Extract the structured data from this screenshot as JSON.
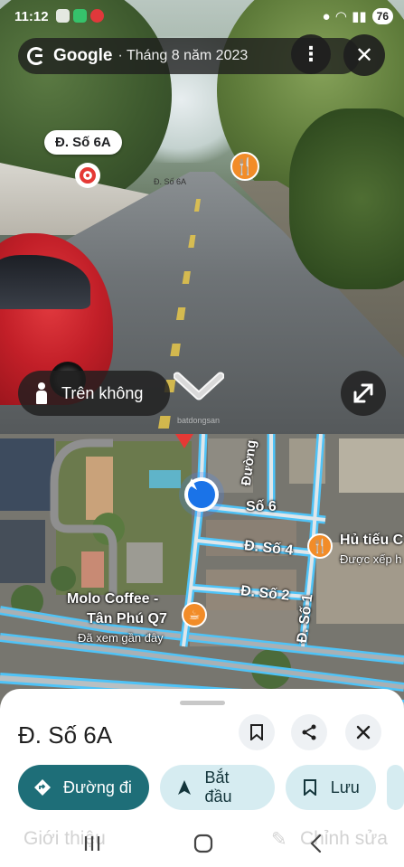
{
  "status_bar": {
    "time": "11:12",
    "battery": "76"
  },
  "street_view": {
    "provider": "Google",
    "capture_date": "· Tháng 8 năm 2023",
    "more_label": "⋮",
    "close_label": "✕",
    "place_label": "Đ. Số 6A",
    "aerial_button": "Trên không",
    "street_tag": "Đ. Số 6A",
    "watermark": "batdongsan"
  },
  "map": {
    "labels": {
      "duong": "Đường",
      "so6": "Số 6",
      "so4": "Đ. Số 4",
      "so2": "Đ. Số 2",
      "so1": "Đ. Số 1",
      "hu_tieu": "Hủ tiếu C",
      "hu_tieu_sub": "Được xếp h",
      "molo": "Molo Coffee -",
      "molo2": "Tân Phú Q7",
      "molo_sub": "Đã xem gần đây"
    }
  },
  "sheet": {
    "title": "Đ. Số 6A",
    "directions": "Đường đi",
    "start": "Bắt đầu",
    "save": "Lưu",
    "intro_tab": "Giới thiệu",
    "edit_tab": "Chỉnh sửa"
  },
  "colors": {
    "primary_chip": "#1e6e78",
    "secondary_chip": "#d6ecf1",
    "road_highlight": "#4fc3f7",
    "food_pin": "#f28c28"
  }
}
